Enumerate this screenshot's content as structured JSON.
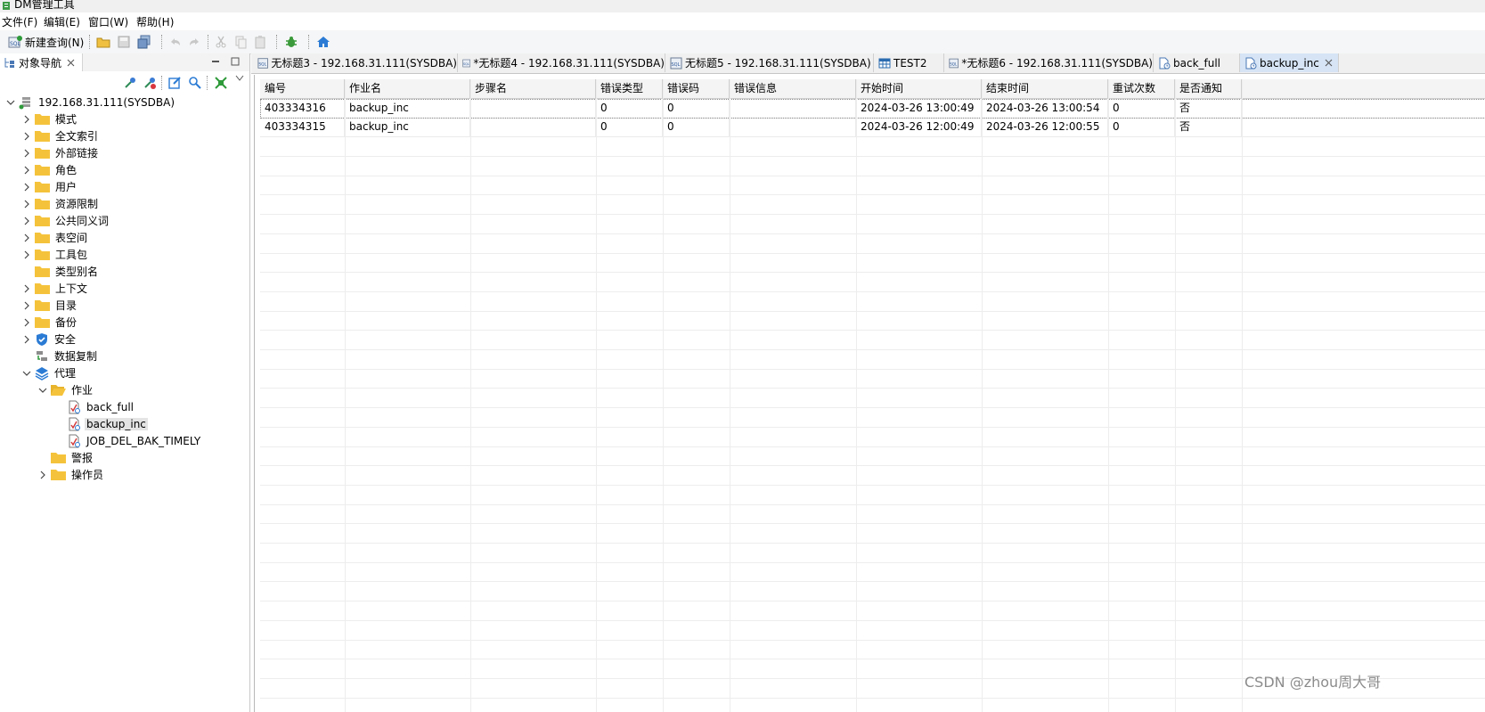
{
  "window": {
    "title": "DM管理工具"
  },
  "menu": [
    "文件(F)",
    "编辑(E)",
    "窗口(W)",
    "帮助(H)"
  ],
  "toolbar": {
    "new_query_label": "新建查询(N)"
  },
  "navigator": {
    "tab_label": "对象导航",
    "tree": {
      "root_label": "192.168.31.111(SYSDBA)",
      "items": [
        "模式",
        "全文索引",
        "外部链接",
        "角色",
        "用户",
        "资源限制",
        "公共同义词",
        "表空间",
        "工具包",
        "类型别名",
        "上下文",
        "目录",
        "备份",
        "安全",
        "数据复制",
        "代理"
      ],
      "agent_children": [
        "作业",
        "警报",
        "操作员"
      ],
      "jobs": [
        "back_full",
        "backup_inc",
        "JOB_DEL_BAK_TIMELY"
      ]
    }
  },
  "tabs": [
    "无标题3 - 192.168.31.111(SYSDBA)",
    "*无标题4 - 192.168.31.111(SYSDBA)",
    "无标题5 - 192.168.31.111(SYSDBA)",
    "TEST2",
    "*无标题6 - 192.168.31.111(SYSDBA)",
    "back_full",
    "backup_inc"
  ],
  "grid": {
    "columns": [
      "编号",
      "作业名",
      "步骤名",
      "错误类型",
      "错误码",
      "错误信息",
      "开始时间",
      "结束时间",
      "重试次数",
      "是否通知"
    ],
    "rows": [
      [
        "403334316",
        "backup_inc",
        "",
        "0",
        "0",
        "",
        "2024-03-26 13:00:49",
        "2024-03-26 13:00:54",
        "0",
        "否"
      ],
      [
        "403334315",
        "backup_inc",
        "",
        "0",
        "0",
        "",
        "2024-03-26 12:00:49",
        "2024-03-26 12:00:55",
        "0",
        "否"
      ]
    ]
  },
  "watermark": "CSDN @zhou周大哥",
  "colors": {
    "folder": "#f5c33b",
    "active_tab": "#d6e4f5",
    "accent_green": "#2e9a3a",
    "accent_blue": "#2b7bd4"
  }
}
